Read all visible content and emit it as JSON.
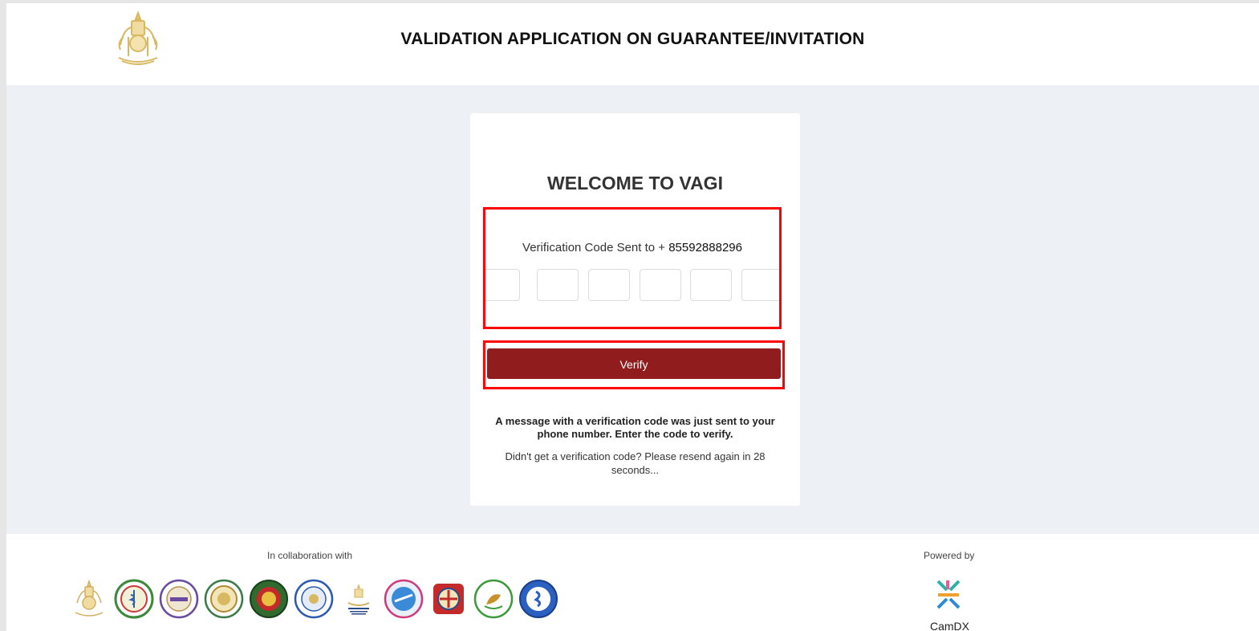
{
  "header": {
    "title": "VALIDATION APPLICATION ON GUARANTEE/INVITATION",
    "logo_icon": "royal-coat-of-arms-icon"
  },
  "card": {
    "welcome": "WELCOME TO VAGI",
    "sent_to_label": "Verification Code Sent to +",
    "phone_number": "85592888296",
    "otp_inputs": [
      "",
      "",
      "",
      "",
      "",
      ""
    ],
    "verify_label": "Verify",
    "message": "A message with a verification code was just sent to your phone number. Enter the code to verify.",
    "resend_text": "Didn't get a verification code? Please resend again in 28 seconds..."
  },
  "footer": {
    "collab_label": "In collaboration with",
    "powered_label": "Powered by",
    "powered_name": "CamDX",
    "partner_logos": [
      "royal-coat-of-arms-icon",
      "ministry-of-health-seal-icon",
      "ministry-seal-icon",
      "ministry-seal-icon",
      "ministry-seal-icon",
      "ministry-seal-icon",
      "ministry-of-foreign-affairs-icon",
      "ministry-seal-icon",
      "ministry-seal-icon",
      "ministry-seal-icon",
      "ministry-seal-icon"
    ]
  },
  "colors": {
    "verify_button": "#911c1e",
    "highlight_border": "#ff0000",
    "page_background": "#edf0f5"
  }
}
